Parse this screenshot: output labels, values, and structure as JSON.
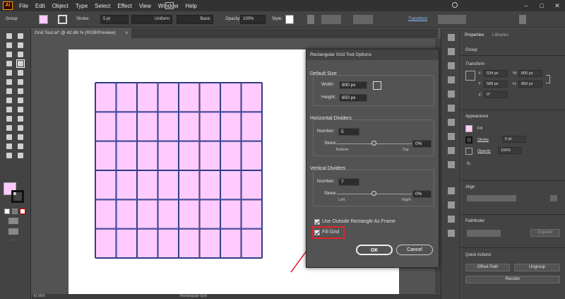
{
  "app": {
    "logo": "Ai"
  },
  "menu": [
    "File",
    "Edit",
    "Object",
    "Type",
    "Select",
    "Effect",
    "View",
    "Window",
    "Help"
  ],
  "window_controls": {
    "minimize": "–",
    "maximize": "□",
    "close": "✕"
  },
  "controlbar": {
    "selection": "Group",
    "stroke_label": "Stroke:",
    "stroke_value": "5 pt",
    "profile": "Uniform",
    "brush": "Basic",
    "opacity_label": "Opacity:",
    "opacity_value": "100%",
    "style_label": "Style:",
    "transform_label": "Transform"
  },
  "document_tab": {
    "title": "Grid Tool.ai* @ 42.86 % (RGB/Preview)",
    "close": "×"
  },
  "statusbar": {
    "zoom": "42.86%",
    "tool": "Rectangular Grid"
  },
  "grid": {
    "rows": 6,
    "cols": 8,
    "fill": "#ffcbff",
    "stroke": "#2a2a5a"
  },
  "dialog": {
    "title": "Rectangular Grid Tool Options",
    "default_size": {
      "title": "Default Size",
      "width_label": "Width:",
      "width": "800 px",
      "height_label": "Height:",
      "height": "850 px"
    },
    "horizontal": {
      "title": "Horizontal Dividers",
      "number_label": "Number:",
      "number": "5",
      "skew_label": "Skew:",
      "skew": "0%",
      "min": "Bottom",
      "max": "Top"
    },
    "vertical": {
      "title": "Vertical Dividers",
      "number_label": "Number:",
      "number": "7",
      "skew_label": "Skew:",
      "skew": "0%",
      "min": "Left",
      "max": "Right"
    },
    "outside_frame": {
      "label": "Use Outside Rectangle As Frame",
      "checked": true
    },
    "fill_grid": {
      "label": "Fill Grid",
      "checked": true
    },
    "ok": "OK",
    "cancel": "Cancel"
  },
  "panels": {
    "tabs": [
      "Properties",
      "Libraries"
    ],
    "selection": "Group",
    "transform": {
      "title": "Transform",
      "x_label": "X:",
      "x": "534 px",
      "y_label": "Y:",
      "y": "588 px",
      "w_label": "W:",
      "w": "800 px",
      "h_label": "H:",
      "h": "850 px",
      "angle_label": "∠:",
      "angle": "0°"
    },
    "appearance": {
      "title": "Appearance",
      "fill": "Fill",
      "stroke": "Stroke",
      "stroke_value": "5 pt",
      "opacity": "Opacity",
      "opacity_value": "100%",
      "fx": "fx."
    },
    "align": {
      "title": "Align"
    },
    "pathfinder": {
      "title": "Pathfinder",
      "expand": "Expand"
    },
    "quick_actions": {
      "title": "Quick Actions",
      "offset_path": "Offset Path",
      "ungroup": "Ungroup",
      "recolor": "Recolor"
    }
  },
  "colors": {
    "fill": "#ffcbff",
    "highlight": "#e0262a",
    "accent": "#ff9a00"
  }
}
